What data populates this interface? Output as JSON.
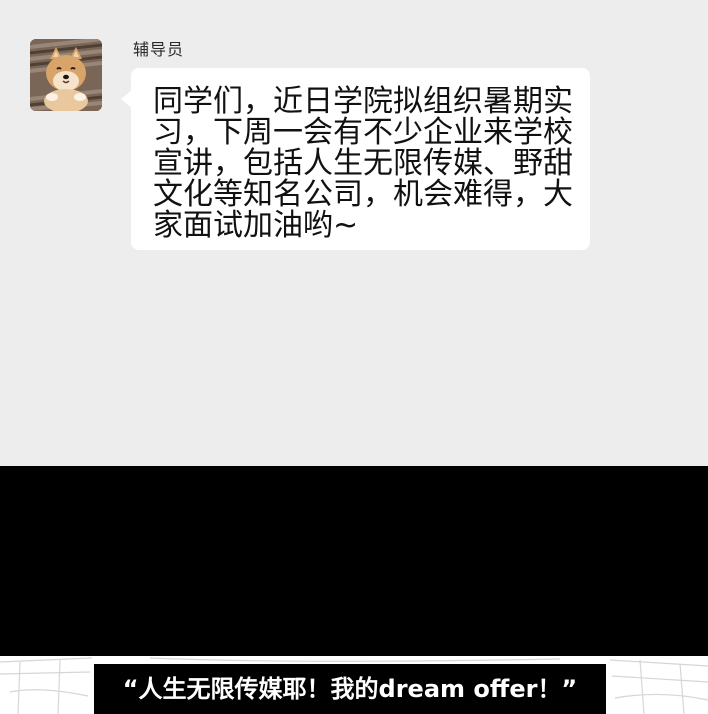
{
  "message": {
    "sender": "辅导员",
    "avatar": "shiba-dog-avatar",
    "text": "同学们，近日学院拟组织暑期实习，下周一会有不少企业来学校宣讲，包括人生无限传媒、野甜文化等知名公司，机会难得，大家面试加油哟~"
  },
  "caption": {
    "text": "“人生无限传媒耶！我的dream offer！”"
  },
  "colors": {
    "chat_background": "#ededed",
    "bubble": "#ffffff",
    "panel": "#000000",
    "caption_text": "#ffffff"
  }
}
